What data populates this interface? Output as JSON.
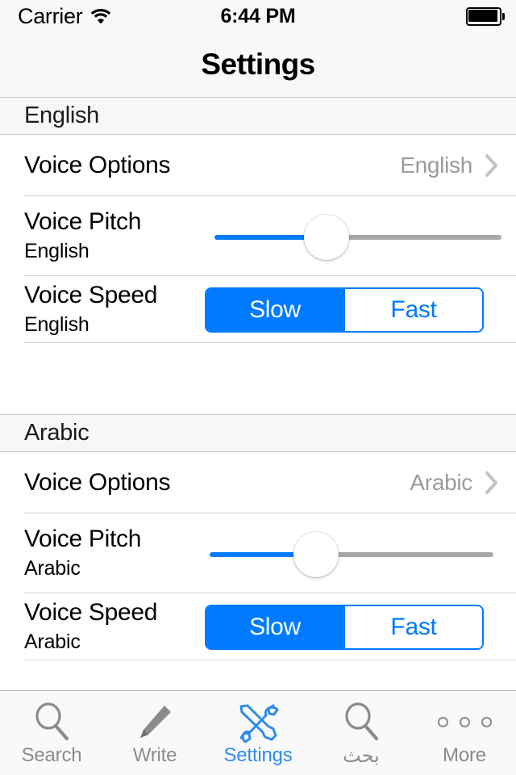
{
  "status_bar": {
    "carrier": "Carrier",
    "wifi_icon": "wifi-icon",
    "time": "6:44 PM",
    "battery_icon": "battery-full-icon"
  },
  "nav_bar": {
    "title": "Settings"
  },
  "colors": {
    "accent": "#007aff",
    "tab_active": "#2f8ceb",
    "value_text": "#9a9a9f",
    "section_bg": "#f7f7f7",
    "separator": "#d4d4d6",
    "slider_track_inactive": "#a8a8a8"
  },
  "sections": [
    {
      "header": "English",
      "voice_options": {
        "title": "Voice Options",
        "value": "English",
        "chevron_icon": "chevron-right-icon"
      },
      "voice_pitch": {
        "title": "Voice Pitch",
        "subtitle": "English",
        "value_percent": 37
      },
      "voice_speed": {
        "title": "Voice Speed",
        "subtitle": "English",
        "options": [
          "Slow",
          "Fast"
        ],
        "selected": "Slow"
      }
    },
    {
      "header": "Arabic",
      "voice_options": {
        "title": "Voice Options",
        "value": "Arabic",
        "chevron_icon": "chevron-right-icon"
      },
      "voice_pitch": {
        "title": "Voice Pitch",
        "subtitle": "Arabic",
        "value_percent": 35
      },
      "voice_speed": {
        "title": "Voice Speed",
        "subtitle": "Arabic",
        "options": [
          "Slow",
          "Fast"
        ],
        "selected": "Slow"
      }
    }
  ],
  "tab_bar": {
    "items": [
      {
        "label": "Search",
        "icon": "magnifier-icon",
        "active": false
      },
      {
        "label": "Write",
        "icon": "pencil-icon",
        "active": false
      },
      {
        "label": "Settings",
        "icon": "wrench-screwdriver-icon",
        "active": true
      },
      {
        "label": "بحث",
        "icon": "magnifier-icon",
        "active": false
      },
      {
        "label": "More",
        "icon": "ellipsis-icon",
        "active": false
      }
    ]
  }
}
